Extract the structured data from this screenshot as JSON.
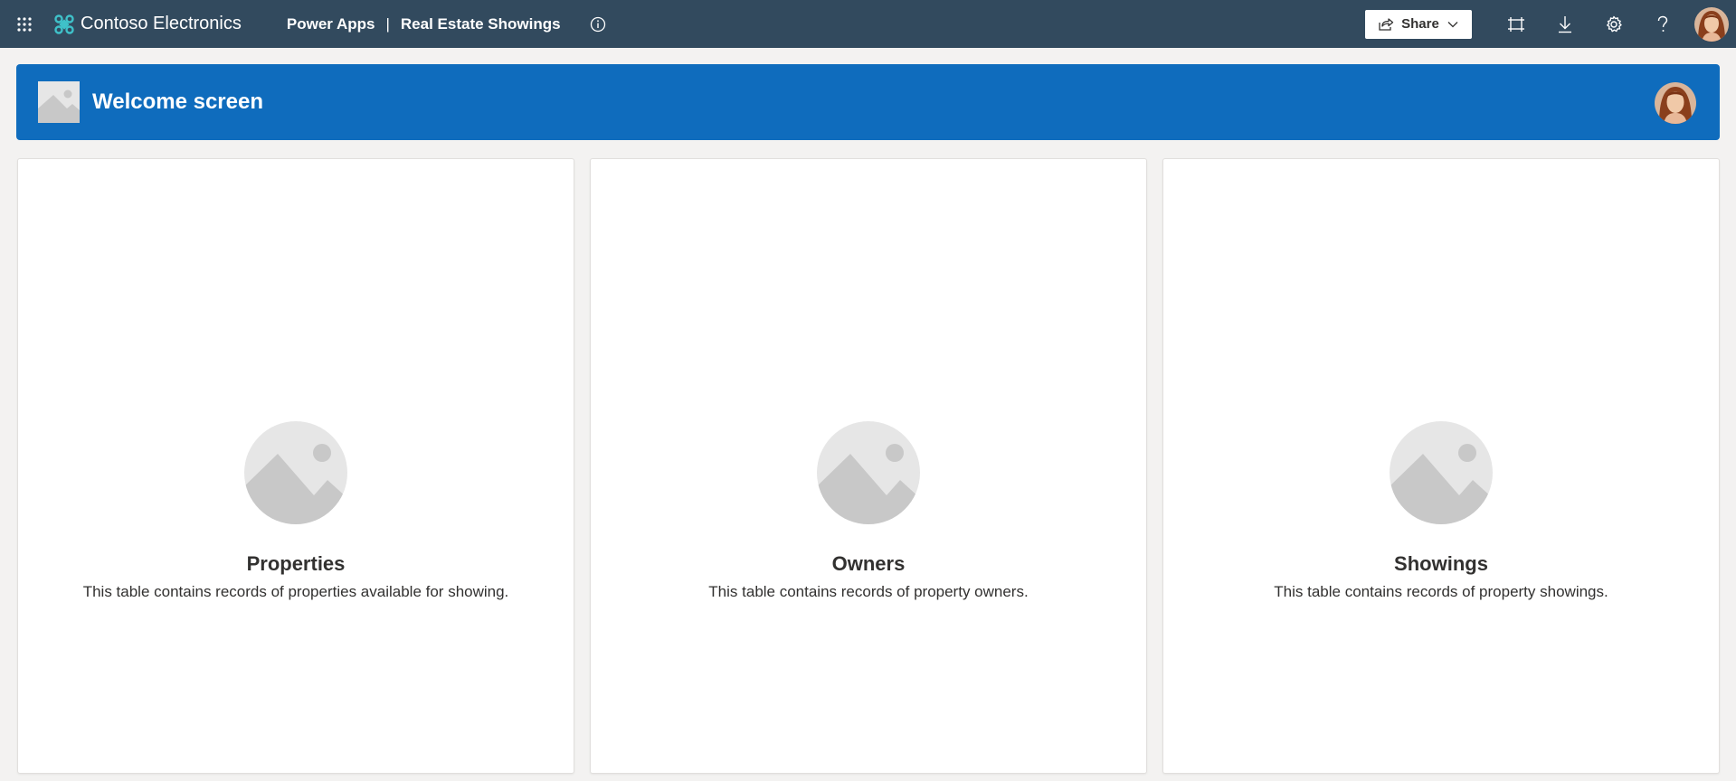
{
  "topbar": {
    "waffle_icon": "waffle-grid-icon",
    "brand_icon": "contoso-logo-icon",
    "brand_name": "Contoso Electronics",
    "app_platform": "Power Apps",
    "separator": "|",
    "app_name": "Real Estate Showings",
    "info_icon": "info-icon",
    "share_label": "Share",
    "actions": [
      {
        "name": "fit-to-window-icon"
      },
      {
        "name": "download-icon"
      },
      {
        "name": "settings-gear-icon"
      },
      {
        "name": "help-icon"
      }
    ],
    "colors": {
      "background": "#324a5e",
      "text": "#ffffff"
    }
  },
  "banner": {
    "title": "Welcome screen",
    "background_color": "#0f6cbd"
  },
  "cards": [
    {
      "title": "Properties",
      "description": "This table contains records of properties available for showing."
    },
    {
      "title": "Owners",
      "description": "This table contains records of property owners."
    },
    {
      "title": "Showings",
      "description": "This table contains records of property showings."
    }
  ]
}
